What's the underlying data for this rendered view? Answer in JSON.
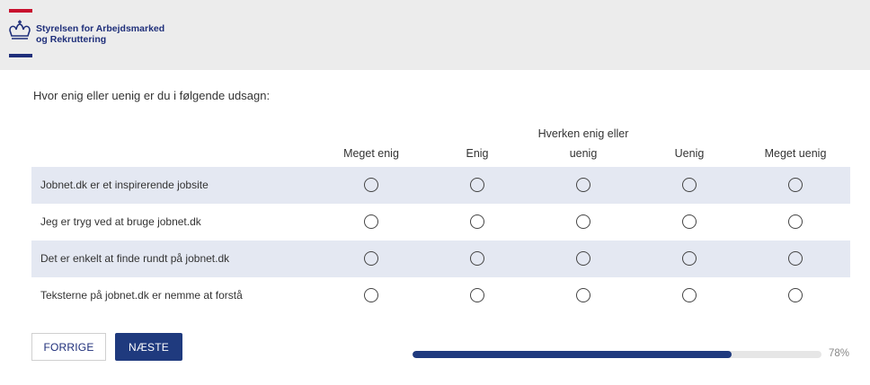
{
  "header": {
    "org_name_line1": "Styrelsen for Arbejdsmarked",
    "org_name_line2": "og Rekruttering",
    "brand_colors": {
      "red": "#c8102e",
      "blue": "#1f2f7a"
    },
    "logo_icon": "crown-icon"
  },
  "survey": {
    "question": "Hvor enig eller uenig er du i følgende udsagn:",
    "columns": [
      {
        "line1": "",
        "line2": "Meget enig"
      },
      {
        "line1": "",
        "line2": "Enig"
      },
      {
        "line1": "Hverken enig eller",
        "line2": "uenig"
      },
      {
        "line1": "",
        "line2": "Uenig"
      },
      {
        "line1": "",
        "line2": "Meget uenig"
      }
    ],
    "statements": [
      "Jobnet.dk er et inspirerende jobsite",
      "Jeg er tryg ved at bruge jobnet.dk",
      "Det er enkelt at finde rundt på jobnet.dk",
      "Teksterne på jobnet.dk er nemme at forstå"
    ]
  },
  "nav": {
    "prev_label": "FORRIGE",
    "next_label": "NÆSTE"
  },
  "progress": {
    "percent": 78,
    "label": "78%",
    "color": "#1f3a7e"
  }
}
